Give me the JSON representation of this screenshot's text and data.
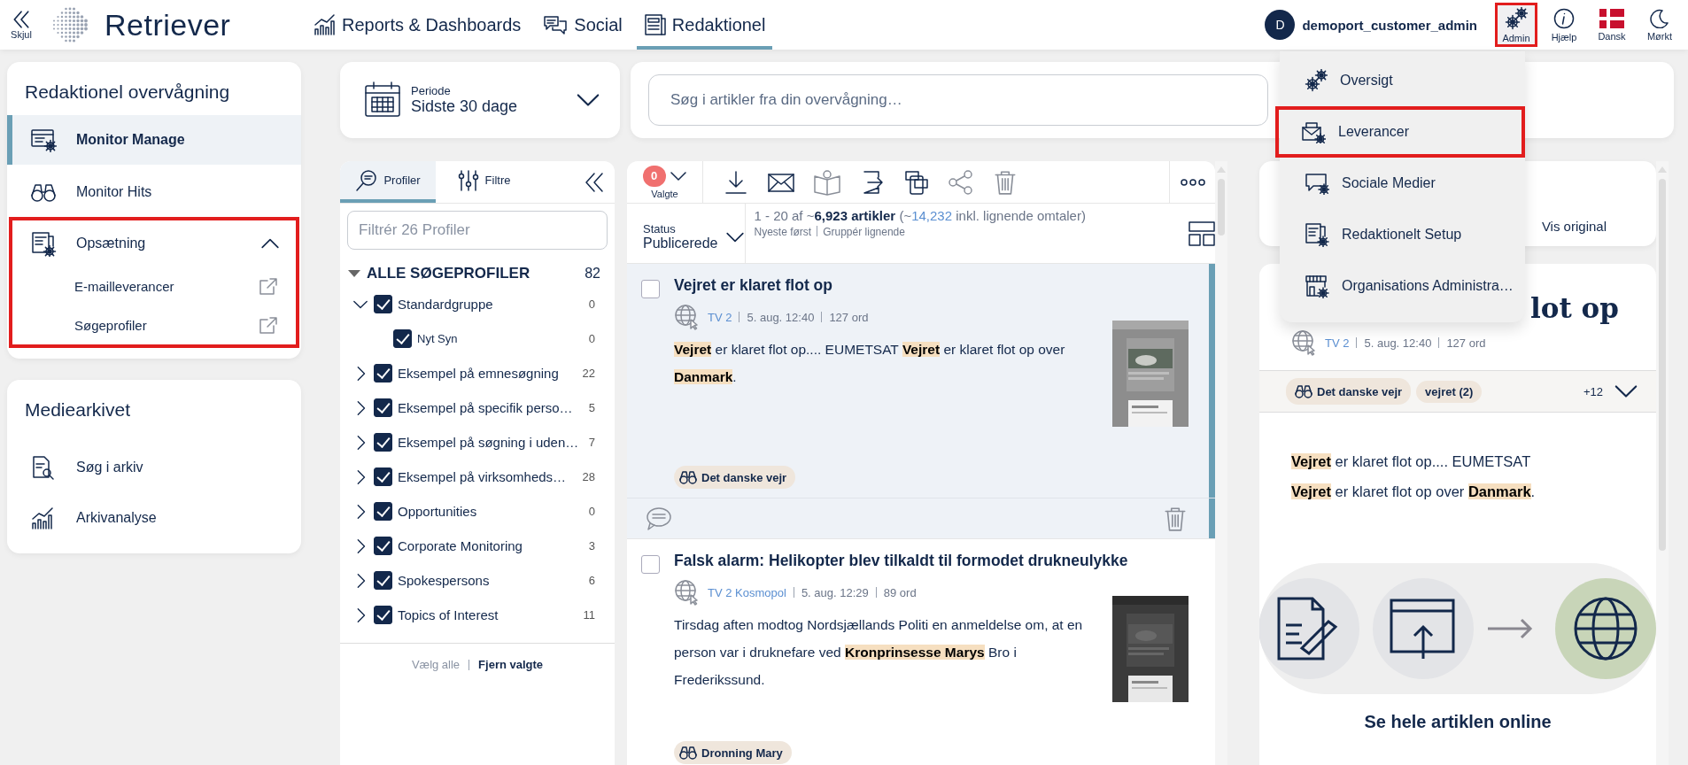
{
  "topbar": {
    "hide_label": "Skjul",
    "logo_text": "Retriever",
    "nav": [
      {
        "label": "Reports & Dashboards",
        "selected": false
      },
      {
        "label": "Social",
        "selected": false
      },
      {
        "label": "Redaktionel",
        "selected": true
      }
    ],
    "user": {
      "initial": "D",
      "name": "demoport_customer_admin"
    },
    "tools": [
      {
        "label": "Admin",
        "selected": true,
        "highlighted": true
      },
      {
        "label": "Hjælp",
        "selected": false,
        "highlighted": false
      },
      {
        "label": "Dansk",
        "selected": false,
        "highlighted": false
      },
      {
        "label": "Mørkt",
        "selected": false,
        "highlighted": false
      }
    ]
  },
  "admin_menu": {
    "items": [
      {
        "label": "Oversigt",
        "highlighted": false
      },
      {
        "label": "Leverancer",
        "highlighted": true
      },
      {
        "label": "Sociale Medier",
        "highlighted": false
      },
      {
        "label": "Redaktionelt Setup",
        "highlighted": false
      },
      {
        "label": "Organisations Administra…",
        "highlighted": false
      }
    ]
  },
  "sidebar": {
    "sections": [
      {
        "title": "Redaktionel overvågning",
        "items": [
          {
            "label": "Monitor Manage",
            "selected": true
          },
          {
            "label": "Monitor Hits",
            "selected": false
          },
          {
            "label": "Opsætning",
            "selected": false,
            "expanded": true,
            "highlighted": true,
            "children": [
              {
                "label": "E-mailleverancer"
              },
              {
                "label": "Søgeprofiler"
              }
            ]
          }
        ]
      },
      {
        "title": "Mediearkivet",
        "items": [
          {
            "label": "Søg i arkiv",
            "selected": false
          },
          {
            "label": "Arkivanalyse",
            "selected": false
          }
        ]
      }
    ]
  },
  "period": {
    "label": "Periode",
    "value": "Sidste 30 dage"
  },
  "search": {
    "placeholder": "Søg i artikler fra din overvågning…"
  },
  "profiles": {
    "tabs": [
      {
        "label": "Profiler",
        "selected": true
      },
      {
        "label": "Filtre",
        "selected": false
      }
    ],
    "filter_placeholder": "Filtrér 26 Profiler",
    "tree": {
      "label": "ALLE SØGEPROFILER",
      "count": "82",
      "expanded": true,
      "children": [
        {
          "label": "Standardgruppe",
          "count": "0",
          "checked": true,
          "expanded": true,
          "children": [
            {
              "label": "Nyt Syn",
              "count": "0",
              "checked": true
            }
          ]
        },
        {
          "label": "Eksempel på emnesøgning",
          "count": "22",
          "checked": true,
          "expanded": false
        },
        {
          "label": "Eksempel på specifik perso…",
          "count": "5",
          "checked": true,
          "expanded": false
        },
        {
          "label": "Eksempel på søgning i uden…",
          "count": "7",
          "checked": true,
          "expanded": false
        },
        {
          "label": "Eksempel på virksomheds…",
          "count": "28",
          "checked": true,
          "expanded": false
        },
        {
          "label": "Opportunities",
          "count": "0",
          "checked": true,
          "expanded": false
        },
        {
          "label": "Corporate Monitoring",
          "count": "3",
          "checked": true,
          "expanded": false
        },
        {
          "label": "Spokespersons",
          "count": "6",
          "checked": true,
          "expanded": false
        },
        {
          "label": "Topics of Interest",
          "count": "11",
          "checked": true,
          "expanded": false
        }
      ]
    },
    "select_all": "Vælg alle",
    "clear": "Fjern valgte"
  },
  "articles": {
    "selected_count": "0",
    "selected_label": "Valgte",
    "status_label": "Status",
    "status_value": "Publicerede",
    "summary": "1 - 20 af ~**6,923 artikler** (~",
    "summary_link": "14,232",
    "summary_end": " inkl. lignende omtaler)",
    "sort": "Nyeste først",
    "group": "Gruppér lignende",
    "items": [
      {
        "title": "Vejret er klaret flot op",
        "source": "TV 2",
        "date": "5. aug. 12:40",
        "words": "127 ord",
        "excerpt": "**Vejret** er klaret flot op.... EUMETSAT **Vejret** er klaret flot op over **Danmark**.",
        "tags": [
          "Det danske vejr"
        ],
        "selected": true,
        "checked": false
      },
      {
        "title": "Falsk alarm: Helikopter blev tilkaldt til formodet drukneulykke",
        "source": "TV 2 Kosmopol",
        "date": "5. aug. 12:29",
        "words": "89 ord",
        "excerpt": "Tirsdag aften modtog Nordsjællands Politi en anmeldelse om, at en person var i druknefare ved **Kronprinsesse Marys** Bro i Frederikssund.",
        "tags": [
          "Dronning Mary"
        ],
        "selected": false,
        "checked": false
      }
    ]
  },
  "reader": {
    "vis_original": "Vis original",
    "title": "lot op",
    "source": "TV 2",
    "date": "5. aug. 12:40",
    "words": "127 ord",
    "tags": [
      {
        "label": "Det danske vejr",
        "kind": "monitor"
      },
      {
        "label": "vejret (2)",
        "kind": "keyword"
      }
    ],
    "more": "+12",
    "body": "**Vejret** er klaret flot op.... EUMETSAT **Vejret** er klaret flot op over **Danmark**.",
    "cta": "Se hele artiklen online"
  }
}
